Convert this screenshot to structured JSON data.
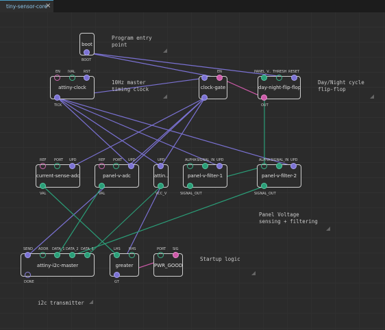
{
  "tab": {
    "label": "tiny-sensor-core",
    "close": "×"
  },
  "comments": {
    "program_entry": "Program entry\npoint",
    "master_timing": "10Hz master\ntiming clock",
    "day_night": "Day/Night cycle\nflip-flop",
    "panel_voltage": "Panel Voltage\nsensing + filtering",
    "startup": "Startup logic",
    "i2c": "i2c transmitter"
  },
  "nodes": {
    "boot": {
      "title": "boot",
      "pins": {
        "out": "BOOT"
      }
    },
    "attiny_clock": {
      "title": "attiny-clock",
      "pins": {
        "en": "EN",
        "ival": "IVAL",
        "rst": "RST",
        "tick": "TICK"
      }
    },
    "clock_gate": {
      "title": "clock-gate",
      "pins": {
        "en": "EN"
      }
    },
    "day_night": {
      "title": "day-night-flip-flop",
      "pins": {
        "panel": "PANEL_V..",
        "thresh": "THRESH",
        "reset": "RESET",
        "out": "OUT"
      }
    },
    "current_sense": {
      "title": "current-sense-adc",
      "pins": {
        "ref": "REF",
        "port": "PORT",
        "upd": "UPD",
        "val": "VAL"
      }
    },
    "panel_adc": {
      "title": "panel-v-adc",
      "pins": {
        "ref": "REF",
        "port": "PORT",
        "upd": "UPD",
        "val": "VAL"
      }
    },
    "attin": {
      "title": "attin..",
      "pins": {
        "upd": "UPD",
        "vcc": "VCC_V"
      }
    },
    "filter1": {
      "title": "panel-v-filter-1",
      "pins": {
        "alpha": "ALPHA",
        "signal_in": "SIGNAL_IN",
        "upd": "UPD",
        "signal_out": "SIGNAL_OUT"
      }
    },
    "filter2": {
      "title": "panel-v-filter-2",
      "pins": {
        "alpha": "ALPHA",
        "signal_in": "SIGNAL_IN",
        "upd": "UPD",
        "signal_out": "SIGNAL_OUT"
      }
    },
    "i2c_master": {
      "title": "attiny-i2c-master",
      "pins": {
        "send": "SEND",
        "addr": "ADDR",
        "data1": "DATA_1",
        "data2": "DATA_2",
        "data3": "DATA_3",
        "done": "DONE"
      }
    },
    "greater": {
      "title": "greater",
      "pins": {
        "lhs": "LHS",
        "rhs": "RHS",
        "gt": "GT"
      }
    },
    "pwr_good": {
      "title": "PWR_GOOD",
      "pins": {
        "port": "PORT",
        "sig": "SIG"
      }
    }
  },
  "colors": {
    "pulse": "#7b72d4",
    "number": "#2b9e78",
    "boolean": "#cc5aa8",
    "accent": "#4aa0c8"
  }
}
